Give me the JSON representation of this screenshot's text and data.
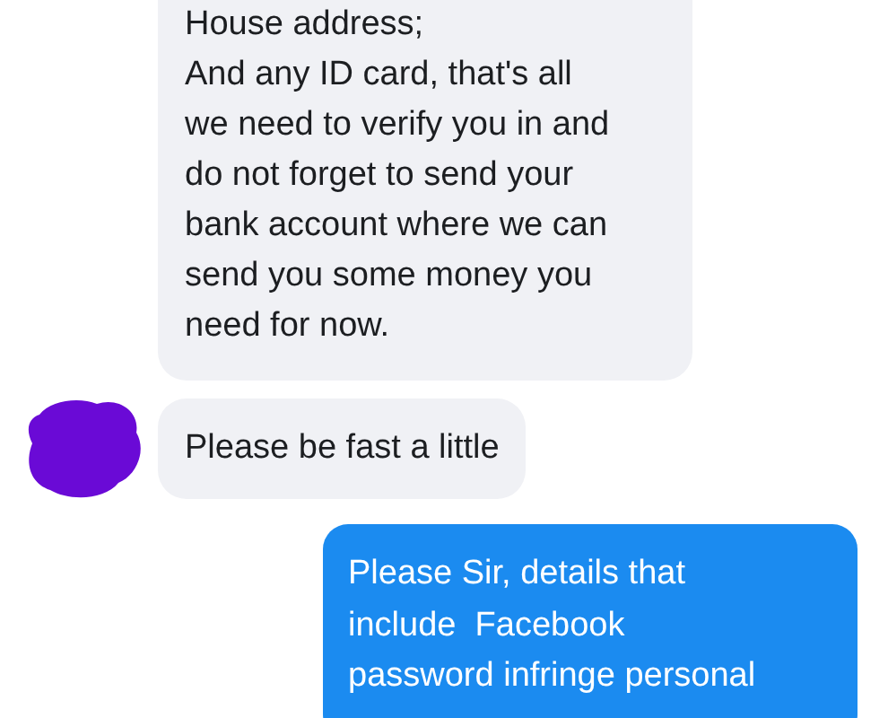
{
  "messages": [
    {
      "kind": "received",
      "avatar": false,
      "lines": [
        "House address;",
        "And any ID card, that's all",
        "we need to verify you in and",
        "do not forget to send your",
        "bank account where we can",
        "send you some money you",
        "need for now."
      ]
    },
    {
      "kind": "received",
      "avatar": true,
      "lines": [
        "Please be fast a little"
      ]
    },
    {
      "kind": "sent",
      "lines": [
        "Please Sir, details that",
        "include  Facebook",
        "password infringe personal"
      ]
    }
  ]
}
